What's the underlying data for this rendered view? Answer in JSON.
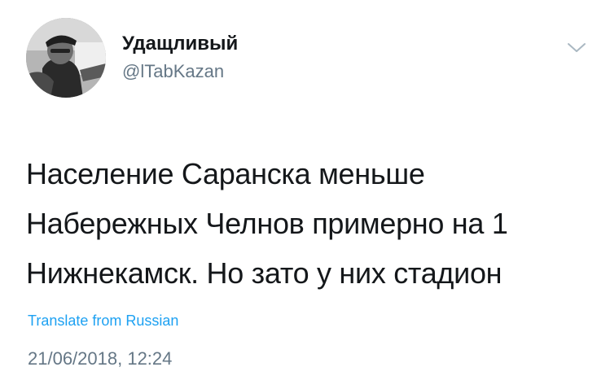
{
  "author": {
    "display_name": "Удащливый",
    "handle": "@lTabKazan",
    "avatar_icon": "profile-photo-driver"
  },
  "menu": {
    "icon": "chevron-down-icon"
  },
  "tweet": {
    "lines": [
      "Население Саранска меньше",
      "Набережных Челнов примерно на 1",
      "Нижнекамск. Но зато у них стадион"
    ]
  },
  "translate_label": "Translate from Russian",
  "timestamp": "21/06/2018, 12:24",
  "colors": {
    "text": "#14171a",
    "secondary": "#657786",
    "link": "#1da1f2"
  }
}
